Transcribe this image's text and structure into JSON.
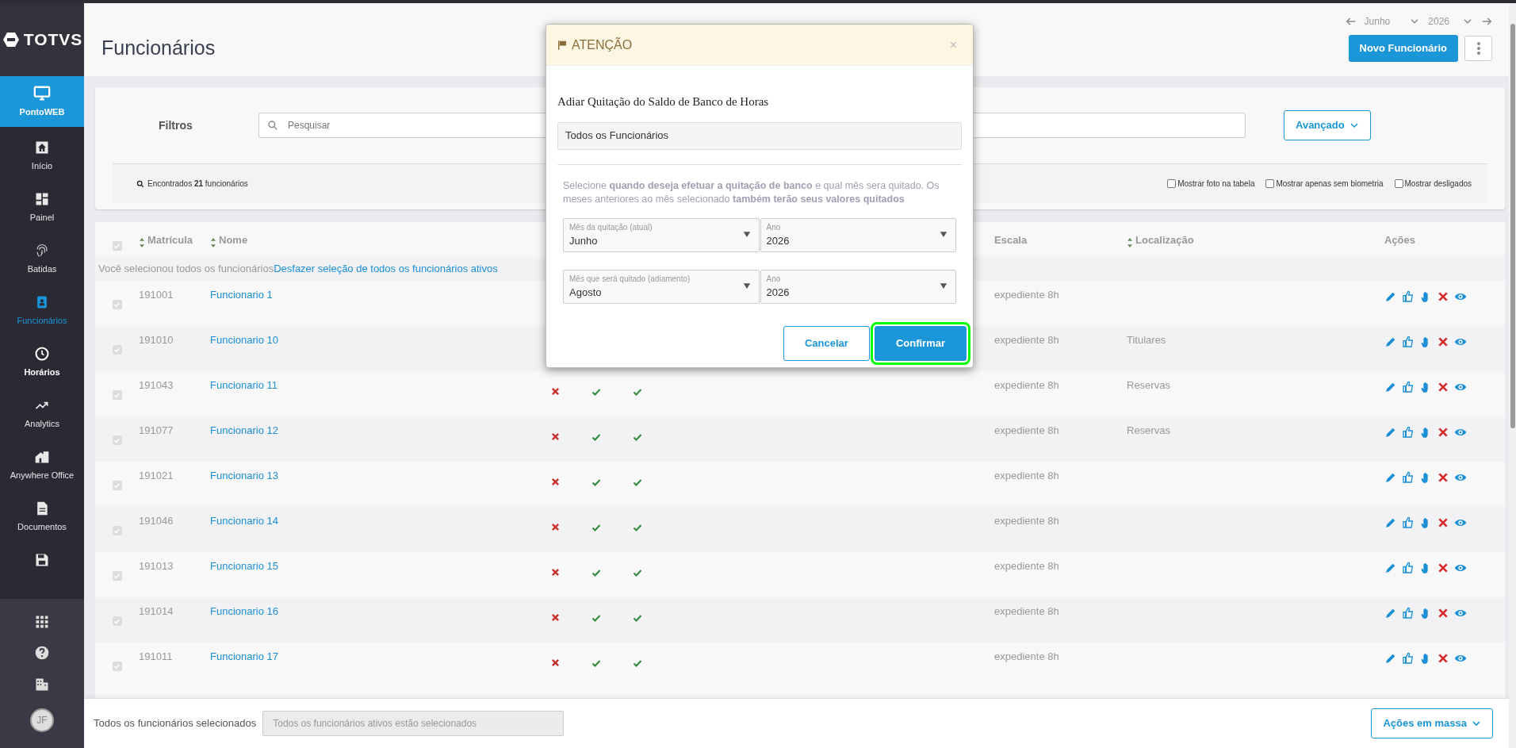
{
  "sidebar": {
    "logo": "TOTVS",
    "module": {
      "label": "PontoWEB",
      "selected": true
    },
    "items": [
      {
        "label": "Início",
        "selected": false,
        "bold": false
      },
      {
        "label": "Painel",
        "selected": false,
        "bold": false
      },
      {
        "label": "Batidas",
        "selected": false,
        "bold": false
      },
      {
        "label": "Funcionários",
        "selected": true,
        "bold": false
      },
      {
        "label": "Horários",
        "selected": false,
        "bold": true
      },
      {
        "label": "Analytics",
        "selected": false,
        "bold": false
      },
      {
        "label": "Anywhere Office",
        "selected": false,
        "bold": false
      },
      {
        "label": "Documentos",
        "selected": false,
        "bold": false
      }
    ],
    "avatar": "JF"
  },
  "page": {
    "title": "Funcionários",
    "month": "Junho",
    "year": "2026",
    "new_button": "Novo Funcionário"
  },
  "filters": {
    "label": "Filtros",
    "search": {
      "placeholder": "Pesquisar"
    },
    "advanced_button": "Avançado",
    "found": "Encontrados **21** funcionários",
    "options": [
      {
        "label": "Mostrar foto na tabela",
        "checked": false
      },
      {
        "label": "Mostrar apenas sem biometria",
        "checked": false
      },
      {
        "label": "Mostrar desligados",
        "checked": false
      }
    ]
  },
  "table": {
    "select_all": true,
    "columns": [
      {
        "label": "Matrícula",
        "sortable": true
      },
      {
        "label": "Nome",
        "sortable": true
      },
      {
        "label": "Escala",
        "sortable": false
      },
      {
        "label": "Localização",
        "sortable": true
      },
      {
        "label": "Ações",
        "sortable": false
      }
    ],
    "selection_note": "Você selecionou todos os funcionários",
    "selection_link": "Desfazer seleção de todos os funcionários ativos",
    "rows": [
      {
        "checked": true,
        "id": "191001",
        "name": "Funcionario 1",
        "escala": "expediente 8h"
      },
      {
        "checked": true,
        "id": "191010",
        "name": "Funcionario 10",
        "escala": "expediente 8h",
        "location": "Titulares"
      },
      {
        "checked": true,
        "id": "191043",
        "name": "Funcionario 11",
        "flags": [
          false,
          true,
          true
        ],
        "escala": "expediente 8h",
        "location": "Reservas"
      },
      {
        "checked": true,
        "id": "191077",
        "name": "Funcionario 12",
        "flags": [
          false,
          true,
          true
        ],
        "escala": "expediente 8h",
        "location": "Reservas"
      },
      {
        "checked": true,
        "id": "191021",
        "name": "Funcionario 13",
        "flags": [
          false,
          true,
          true
        ],
        "escala": "expediente 8h"
      },
      {
        "checked": true,
        "id": "191046",
        "name": "Funcionario 14",
        "flags": [
          false,
          true,
          true
        ],
        "escala": "expediente 8h"
      },
      {
        "checked": true,
        "id": "191013",
        "name": "Funcionario 15",
        "flags": [
          false,
          true,
          true
        ],
        "escala": "expediente 8h"
      },
      {
        "checked": true,
        "id": "191014",
        "name": "Funcionario 16",
        "flags": [
          false,
          true,
          true
        ],
        "escala": "expediente 8h"
      },
      {
        "checked": true,
        "id": "191011",
        "name": "Funcionario 17",
        "flags": [
          false,
          true,
          true
        ],
        "escala": "expediente 8h"
      }
    ]
  },
  "bottom_bar": {
    "label": "Todos os funcionários selecionados",
    "field": "Todos os funcionários ativos estão selecionados",
    "button": "Ações em massa"
  },
  "modal": {
    "title": "ATENÇÃO",
    "close": "×",
    "heading": "Adiar Quitação do Saldo de Banco de Horas",
    "target": "Todos os Funcionários",
    "description": "Selecione **quando deseja efetuar a quitação de banco** e qual mês sera quitado. Os meses anteriores ao mês selecionado **também terão seus valores quitados**",
    "selects": [
      [
        {
          "label": "Mês da quitação (atual)",
          "value": "Junho"
        },
        {
          "label": "Ano",
          "value": "2026"
        }
      ],
      [
        {
          "label": "Mês que será quitado (adiamento)",
          "value": "Agosto"
        },
        {
          "label": "Ano",
          "value": "2026"
        }
      ]
    ],
    "buttons": [
      {
        "label": "Cancelar",
        "kind": "secondary",
        "focused": false
      },
      {
        "label": "Confirmar",
        "kind": "primary",
        "focused": true
      }
    ]
  }
}
